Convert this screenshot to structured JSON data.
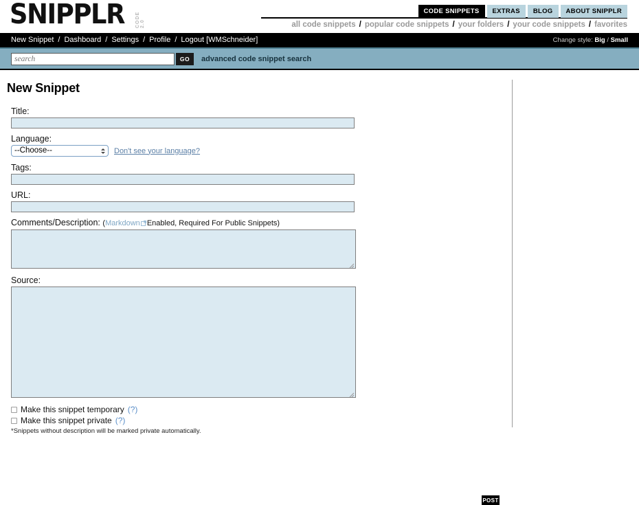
{
  "brand": {
    "name": "SNIPPLR",
    "tagline": "CODE 2.0"
  },
  "header": {
    "tabs": [
      {
        "label": "CODE SNIPPETS",
        "active": true
      },
      {
        "label": "EXTRAS",
        "active": false
      },
      {
        "label": "BLOG",
        "active": false
      },
      {
        "label": "ABOUT SNIPPLR",
        "active": false
      }
    ],
    "subnav": [
      "all code snippets",
      "popular code snippets",
      "your folders",
      "your code snippets",
      "favorites"
    ],
    "separator": "/"
  },
  "navbar": {
    "items": [
      "New Snippet",
      "Dashboard",
      "Settings",
      "Profile",
      "Logout [WMSchneider]"
    ],
    "separator": "/",
    "style_prefix": "Change style:",
    "style_big": "Big",
    "style_sep": "/",
    "style_small": "Small"
  },
  "search": {
    "placeholder": "search",
    "value": "",
    "go_label": "GO",
    "advanced_label": "advanced code snippet search"
  },
  "main": {
    "page_title": "New Snippet",
    "fields": {
      "title_label": "Title:",
      "title_value": "",
      "language_label": "Language:",
      "language_selected": "--Choose--",
      "language_link": "Don't see your language?",
      "tags_label": "Tags:",
      "tags_value": "",
      "url_label": "URL:",
      "url_value": "",
      "comments_label": "Comments/Description:",
      "comments_note_open": "(",
      "comments_note_link": "Markdown",
      "comments_note_rest": "Enabled, Required For Public Snippets)",
      "comments_value": "",
      "source_label": "Source:",
      "source_value": ""
    },
    "options": [
      {
        "label": "Make this snippet temporary",
        "help": "(?)",
        "checked": false
      },
      {
        "label": "Make this snippet private",
        "help": "(?)",
        "checked": false
      }
    ],
    "footnote": "*Snippets without description will be marked private automatically.",
    "post_label": "POST"
  },
  "colors": {
    "search_band": "#85aec0",
    "tab_inactive": "#b9d4de",
    "input_fill": "#dbeaf2",
    "link_blue": "#5b8fc9"
  }
}
